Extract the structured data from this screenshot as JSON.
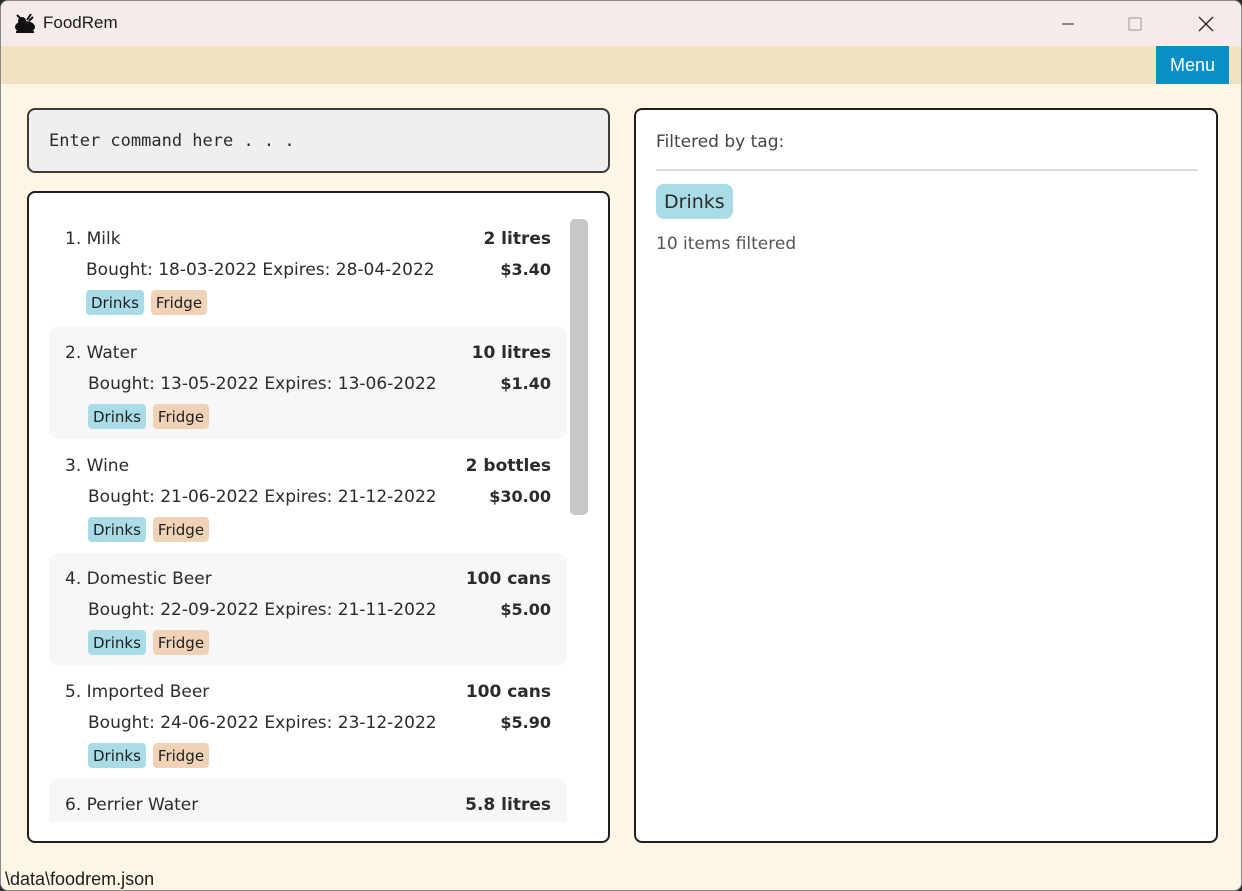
{
  "window": {
    "title": "FoodRem"
  },
  "menubar": {
    "menu_label": "Menu"
  },
  "command": {
    "placeholder": "Enter command here . . ."
  },
  "items": [
    {
      "index": "1.",
      "name": "Milk",
      "quantity": "2 litres",
      "dates": "Bought: 18-03-2022  Expires: 28-04-2022",
      "price": "$3.40",
      "tags": [
        "Drinks",
        "Fridge"
      ]
    },
    {
      "index": "2.",
      "name": "Water",
      "quantity": "10 litres",
      "dates": "Bought: 13-05-2022  Expires: 13-06-2022",
      "price": "$1.40",
      "tags": [
        "Drinks",
        "Fridge"
      ]
    },
    {
      "index": "3.",
      "name": "Wine",
      "quantity": "2 bottles",
      "dates": "Bought: 21-06-2022  Expires: 21-12-2022",
      "price": "$30.00",
      "tags": [
        "Drinks",
        "Fridge"
      ]
    },
    {
      "index": "4.",
      "name": "Domestic Beer",
      "quantity": "100 cans",
      "dates": "Bought: 22-09-2022  Expires: 21-11-2022",
      "price": "$5.00",
      "tags": [
        "Drinks",
        "Fridge"
      ]
    },
    {
      "index": "5.",
      "name": "Imported Beer",
      "quantity": "100 cans",
      "dates": "Bought: 24-06-2022  Expires: 23-12-2022",
      "price": "$5.90",
      "tags": [
        "Drinks",
        "Fridge"
      ]
    },
    {
      "index": "6.",
      "name": "Perrier Water",
      "quantity": "5.8 litres",
      "dates": "",
      "price": "",
      "tags": []
    }
  ],
  "filter": {
    "heading": "Filtered by tag:",
    "tag": "Drinks",
    "count_text": "10 items filtered"
  },
  "statusbar": {
    "path": "\\data\\foodrem.json"
  },
  "colors": {
    "accent": "#0b8ec5",
    "tag_drinks": "#a9dce6",
    "tag_fridge": "#f0d2b6",
    "background": "#fdf6e4"
  }
}
